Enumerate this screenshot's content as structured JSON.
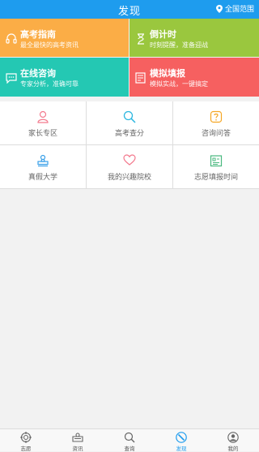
{
  "header": {
    "title": "发现",
    "region": "全国范围"
  },
  "tiles": [
    {
      "title": "高考指南",
      "subtitle": "最全最快的高考资讯",
      "color": "#fbad46",
      "icon": "headphones-icon"
    },
    {
      "title": "倒计时",
      "subtitle": "时刻提醒，准备迎战",
      "color": "#9ac73e",
      "icon": "hourglass-icon"
    },
    {
      "title": "在线咨询",
      "subtitle": "专家分析，准确可靠",
      "color": "#24c8b3",
      "icon": "chat-bubble-icon"
    },
    {
      "title": "模拟填报",
      "subtitle": "模拟实战，一键搞定",
      "color": "#f66060",
      "icon": "edit-form-icon"
    }
  ],
  "grid": [
    {
      "label": "家长专区",
      "icon": "person-icon",
      "color": "#f37a8e"
    },
    {
      "label": "高考查分",
      "icon": "search-icon",
      "color": "#2db7e0"
    },
    {
      "label": "咨询问答",
      "icon": "question-icon",
      "color": "#f5a623"
    },
    {
      "label": "真假大学",
      "icon": "stamp-icon",
      "color": "#3aa0e8"
    },
    {
      "label": "我的兴趣院校",
      "icon": "heart-icon",
      "color": "#f37a8e"
    },
    {
      "label": "志愿填报时间",
      "icon": "calendar-icon",
      "color": "#49b87e"
    }
  ],
  "bottom_nav": [
    {
      "label": "志愿",
      "icon": "target-icon",
      "active": false
    },
    {
      "label": "资讯",
      "icon": "news-icon",
      "active": false
    },
    {
      "label": "查询",
      "icon": "search-icon",
      "active": false
    },
    {
      "label": "发现",
      "icon": "compass-icon",
      "active": true
    },
    {
      "label": "我的",
      "icon": "user-icon",
      "active": false
    }
  ],
  "colors": {
    "brand": "#1e9cee"
  }
}
